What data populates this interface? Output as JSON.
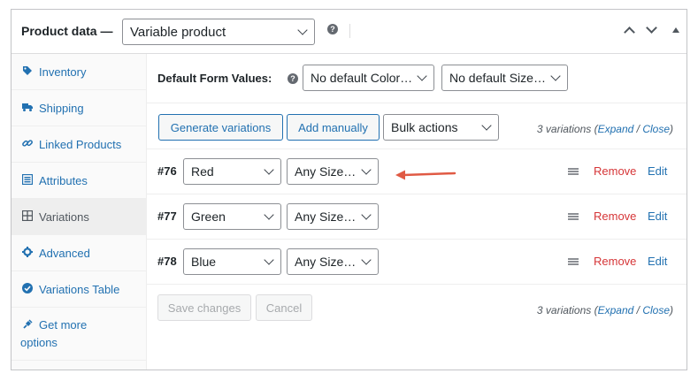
{
  "header": {
    "title": "Product data —",
    "product_type": "Variable product",
    "help": "?"
  },
  "sidebar": {
    "items": [
      {
        "label": "Inventory",
        "icon": "tag-icon"
      },
      {
        "label": "Shipping",
        "icon": "truck-icon"
      },
      {
        "label": "Linked Products",
        "icon": "link-icon"
      },
      {
        "label": "Attributes",
        "icon": "list-icon"
      },
      {
        "label": "Variations",
        "icon": "grid-icon",
        "active": true
      },
      {
        "label": "Advanced",
        "icon": "gear-icon"
      },
      {
        "label": "Variations Table",
        "icon": "check-circle-icon"
      },
      {
        "label": "Get more options",
        "icon": "plugin-icon"
      }
    ]
  },
  "defaults": {
    "label": "Default Form Values:",
    "help": "?",
    "color_value": "No default Color…",
    "size_value": "No default Size…"
  },
  "toolbar": {
    "generate_label": "Generate variations",
    "add_label": "Add manually",
    "bulk_label": "Bulk actions",
    "count_text": "3 variations (",
    "expand": "Expand",
    "sep": " / ",
    "close": "Close",
    "close_paren": ")"
  },
  "variations": [
    {
      "id": "#76",
      "color": "Red",
      "size": "Any Size…",
      "remove": "Remove",
      "edit": "Edit"
    },
    {
      "id": "#77",
      "color": "Green",
      "size": "Any Size…",
      "remove": "Remove",
      "edit": "Edit"
    },
    {
      "id": "#78",
      "color": "Blue",
      "size": "Any Size…",
      "remove": "Remove",
      "edit": "Edit"
    }
  ],
  "footer": {
    "save_label": "Save changes",
    "cancel_label": "Cancel"
  },
  "colors": {
    "accent": "#2271b1",
    "danger": "#d63638",
    "annotation_arrow": "#e05a44"
  }
}
